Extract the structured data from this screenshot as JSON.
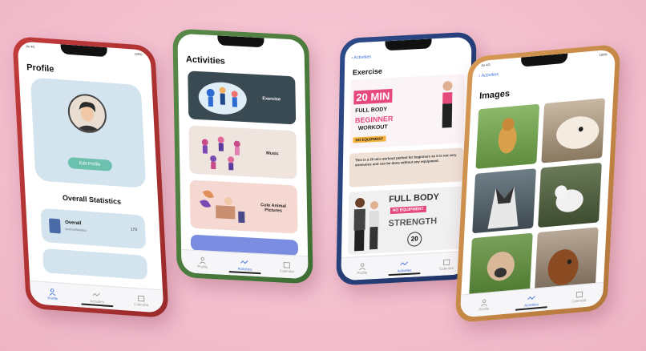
{
  "status": {
    "carrier": "Jio 4G",
    "battery": "100%"
  },
  "tabs": {
    "profile": "Profile",
    "activities": "Activities",
    "calendar": "Calendar"
  },
  "profile": {
    "title": "Profile",
    "edit_label": "Edit Profile",
    "stats_title": "Overall Statistics",
    "stats": [
      {
        "name": "Overall",
        "sub": "landing/Statistics",
        "value": "170"
      }
    ]
  },
  "activities": {
    "title": "Activities",
    "items": [
      {
        "label": "Exercise"
      },
      {
        "label": "Music"
      },
      {
        "label": "Cute Animal Pictures"
      }
    ]
  },
  "exercise": {
    "back": "Activities",
    "title": "Exercise",
    "poster1": {
      "big": "20 MIN",
      "l1": "FULL BODY",
      "l2": "BEGINNER",
      "l3": "WORKOUT",
      "tag": "NO EQUIPMENT"
    },
    "description": "This is a 20 min workout perfect for beginners as it is not very strenuous and can be done without any equipment.",
    "poster2": {
      "l1": "FULL BODY",
      "tag": "NO EQUIPMENT",
      "l2": "STRENGTH",
      "num": "20"
    }
  },
  "images": {
    "back": "Activities",
    "title": "Images"
  },
  "colors": {
    "accent": "#3b6fd8",
    "card": "#d3e4ee",
    "teal": "#6cc0ae"
  }
}
